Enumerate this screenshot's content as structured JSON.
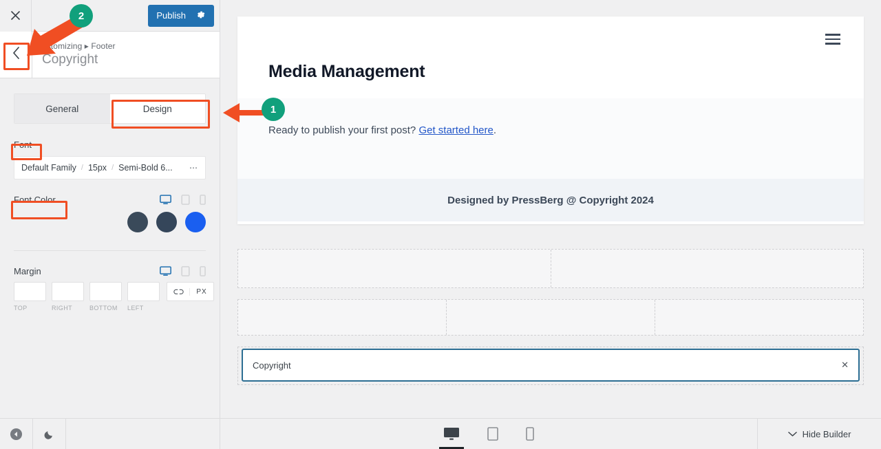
{
  "app": {
    "panel": {
      "close_icon": "close-icon",
      "publish_label": "Publish",
      "gear_icon": "gear-icon",
      "back_icon": "chevron-left-icon",
      "breadcrumb": "ustomizing ▸ Footer",
      "title": "Copyright"
    },
    "tabs": [
      {
        "label": "General",
        "active": false
      },
      {
        "label": "Design",
        "active": true
      }
    ],
    "font": {
      "label": "Font",
      "family": "Default Family",
      "size": "15px",
      "weight": "Semi-Bold 6...",
      "more_icon": "ellipsis-icon"
    },
    "font_color": {
      "label": "Font Color",
      "devices": [
        "desktop-icon",
        "tablet-icon",
        "mobile-icon"
      ],
      "active_device": "desktop-icon",
      "swatches": [
        "#3a4a5a",
        "#35465a",
        "#1a5ff0"
      ]
    },
    "margin": {
      "label": "Margin",
      "devices": [
        "desktop-icon",
        "tablet-icon",
        "mobile-icon"
      ],
      "active_device": "desktop-icon",
      "values": [
        "",
        "",
        "",
        ""
      ],
      "placeholders": [
        "",
        "",
        "",
        ""
      ],
      "labels": [
        "TOP",
        "RIGHT",
        "BOTTOM",
        "LEFT"
      ],
      "link_icon": "link-icon",
      "unit": "PX"
    },
    "bottom_bar": {
      "collapse_icon": "collapse-left-icon",
      "theme_icon": "moon-icon",
      "devices": [
        {
          "icon": "desktop-icon",
          "active": true
        },
        {
          "icon": "tablet-icon",
          "active": false
        },
        {
          "icon": "mobile-icon",
          "active": false
        }
      ],
      "hide_builder_label": "Hide Builder",
      "hide_builder_icon": "chevron-down-icon"
    }
  },
  "preview": {
    "menu_icon": "hamburger-menu-icon",
    "site_title": "Media Management",
    "body_text_prefix": "Ready to publish your first post? ",
    "body_link": "Get started here",
    "body_text_suffix": ".",
    "footer_text": "Designed by PressBerg @ Copyright 2024"
  },
  "builder": {
    "rows": [
      {
        "cells": 2
      },
      {
        "cells": 3
      }
    ],
    "widget": {
      "label": "Copyright",
      "remove_icon": "close-icon"
    }
  },
  "annotations": {
    "badges": [
      {
        "number": "1"
      },
      {
        "number": "2"
      }
    ],
    "accent": "#f04e23",
    "badge_color": "#11a07c"
  }
}
